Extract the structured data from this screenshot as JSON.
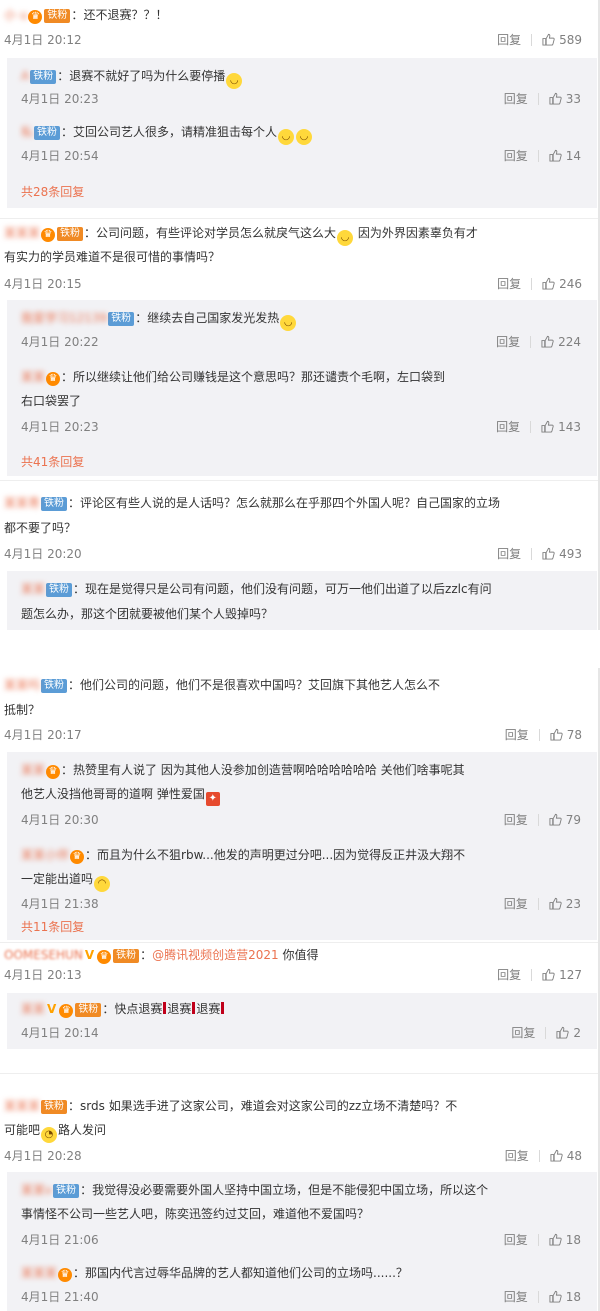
{
  "common": {
    "reply_label": "回复",
    "fan_badge": "铁粉"
  },
  "c1": {
    "user": "小 u",
    "text": "还不退赛？？！",
    "time": "4月1日 20:12",
    "likes": "589",
    "replies": [
      {
        "user": "A",
        "text": "退赛不就好了吗为什么要停播",
        "time": "4月1日 20:23",
        "likes": "33"
      },
      {
        "user": "私",
        "text": "艾回公司艺人很多，请精准狙击每个人",
        "time": "4月1日 20:54",
        "likes": "14"
      }
    ],
    "more": "共28条回复"
  },
  "c2": {
    "user": "某某某",
    "text_line1": "公司问题，有些评论对学员怎么就戾气这么大",
    "text_line1b": "因为外界因素辜负有才",
    "text_line2": "有实力的学员难道不是很可惜的事情吗？",
    "time": "4月1日 20:15",
    "likes": "246",
    "replies": [
      {
        "user": "我爱学习12139",
        "text": "继续去自己国家发光发热",
        "time": "4月1日 20:22",
        "likes": "224"
      },
      {
        "user": "某某",
        "text_line1": "所以继续让他们给公司赚钱是这个意思吗？那还谴责个毛啊，左口袋到",
        "text_line2": "右口袋罢了",
        "time": "4月1日 20:23",
        "likes": "143"
      }
    ],
    "more": "共41条回复"
  },
  "c3": {
    "user": "某某青",
    "text_line1": "评论区有些人说的是人话吗？怎么就那么在乎那四个外国人呢？自己国家的立场",
    "text_line2": "都不要了吗？",
    "time": "4月1日 20:20",
    "likes": "493",
    "reply": {
      "user": "某某",
      "text_line1": "现在是觉得只是公司有问题，他们没有问题，可万一他们出道了以后zzlc有问",
      "text_line2": "题怎么办，那这个团就要被他们某个人毁掉吗？"
    }
  },
  "c4": {
    "user": "某某吗",
    "text_line1": "他们公司的问题，他们不是很喜欢中国吗？艾回旗下其他艺人怎么不",
    "text_line2": "抵制？",
    "time": "4月1日 20:17",
    "likes": "78",
    "replies": [
      {
        "user": "某某",
        "text_line1": "热赞里有人说了 因为其他人没参加创造营啊哈哈哈哈哈哈 关他们啥事呢其",
        "text_line2": "他艺人没挡他哥哥的道啊 弹性爱国",
        "time": "4月1日 20:30",
        "likes": "79"
      },
      {
        "user": "某某小伴",
        "text_line1": "而且为什么不狙rbw...他发的声明更过分吧...因为觉得反正井汲大翔不",
        "text_line2": "一定能出道吗",
        "time": "4月1日 21:38",
        "likes": "23"
      }
    ],
    "more": "共11条回复"
  },
  "c5": {
    "user": "OOMESEHUN",
    "mention": "@腾讯视频创造营2021",
    "text": "你值得",
    "time": "4月1日 20:13",
    "likes": "127",
    "reply": {
      "user": "某某",
      "text_a": "快点退赛",
      "text_b": "退赛",
      "text_c": "退赛",
      "time": "4月1日 20:14",
      "likes": "2"
    }
  },
  "c6": {
    "user": "某某某",
    "text_line1": "srds  如果选手进了这家公司，难道会对这家公司的zz立场不清楚吗？不",
    "text_line2": "可能吧",
    "text_line2b": "路人发问",
    "time": "4月1日 20:28",
    "likes": "48",
    "replies": [
      {
        "user": "某某v",
        "text_line1": "我觉得没必要需要外国人坚持中国立场，但是不能侵犯中国立场，所以这个",
        "text_line2": "事情怪不公司一些艺人吧，陈奕迅签约过艾回，难道他不爱国吗？",
        "time": "4月1日 21:06",
        "likes": "18"
      },
      {
        "user": "某某某",
        "text": "那国内代言过辱华品牌的艺人都知道他们公司的立场吗......？",
        "time": "4月1日 21:40",
        "likes": "18"
      }
    ]
  }
}
